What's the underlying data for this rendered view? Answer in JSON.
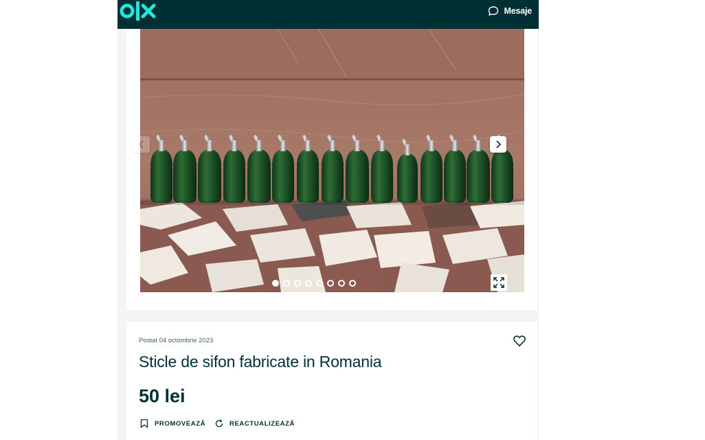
{
  "header": {
    "logo_text": "OLX",
    "messages_label": "Mesaje",
    "background": "#002f34",
    "logo_color": "#23e5db"
  },
  "gallery": {
    "photo_description": "green soda siphon bottles lined up on a mosaic floor",
    "current_image": 1,
    "total_images": 8,
    "prev_icon": "chevron-left-icon",
    "next_icon": "chevron-right-icon",
    "expand_icon": "expand-icon"
  },
  "listing": {
    "posted": "Postat 04 octombrie 2023",
    "title": "Sticle de sifon fabricate in Romania",
    "price": "50 lei",
    "favorite_icon": "heart-icon"
  },
  "actions": {
    "promote": "PROMOVEAZĂ",
    "refresh": "REACTUALIZEAZĂ"
  }
}
